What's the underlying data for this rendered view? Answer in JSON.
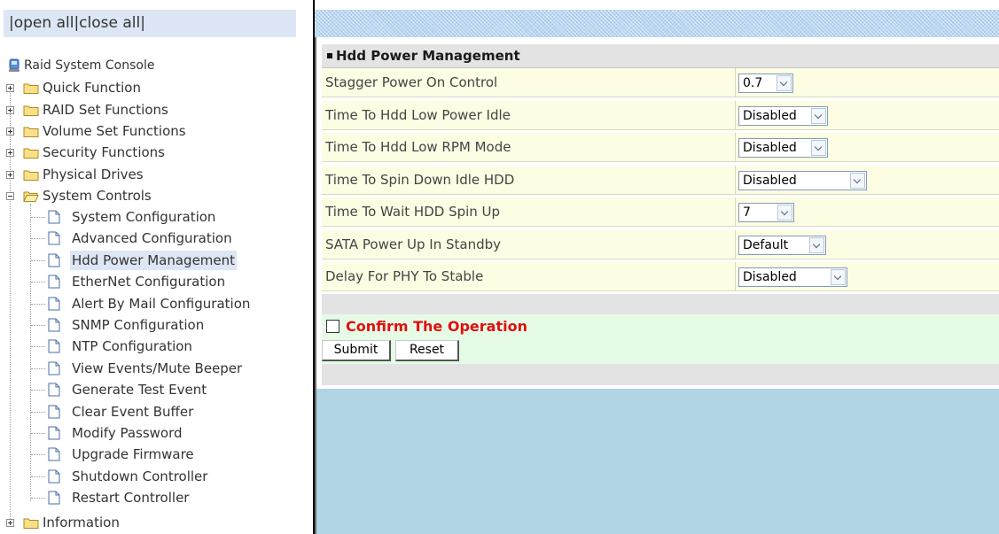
{
  "left_pane": {
    "open_all": "open all",
    "close_all": "close all",
    "root_label": "Raid System Console",
    "folders": {
      "quick_function": "Quick Function",
      "raid_set_functions": "RAID Set Functions",
      "volume_set_functions": "Volume Set Functions",
      "security_functions": "Security Functions",
      "physical_drives": "Physical Drives",
      "system_controls": "System Controls",
      "information": "Information"
    },
    "system_controls_items": [
      "System Configuration",
      "Advanced Configuration",
      "Hdd Power Management",
      "EtherNet Configuration",
      "Alert By Mail Configuration",
      "SNMP Configuration",
      "NTP Configuration",
      "View Events/Mute Beeper",
      "Generate Test Event",
      "Clear Event Buffer",
      "Modify Password",
      "Upgrade Firmware",
      "Shutdown Controller",
      "Restart Controller"
    ],
    "selected_item": "Hdd Power Management"
  },
  "form": {
    "title": "Hdd Power Management",
    "rows": [
      {
        "label": "Stagger Power On Control",
        "value": "0.7"
      },
      {
        "label": "Time To Hdd Low Power Idle",
        "value": "Disabled"
      },
      {
        "label": "Time To Hdd Low RPM Mode",
        "value": "Disabled"
      },
      {
        "label": "Time To Spin Down Idle HDD",
        "value": "Disabled"
      },
      {
        "label": "Time To Wait HDD Spin Up",
        "value": "7"
      },
      {
        "label": "SATA Power Up In Standby",
        "value": "Default"
      },
      {
        "label": "Delay For PHY To Stable",
        "value": "Disabled"
      }
    ],
    "confirm_label": "Confirm The Operation",
    "submit_label": "Submit",
    "reset_label": "Reset"
  },
  "colors": {
    "confirm_text": "#e01010",
    "row_background": "#fdfde3",
    "selected_background": "#dde6f4",
    "bottom_area": "#b1d4e4"
  }
}
